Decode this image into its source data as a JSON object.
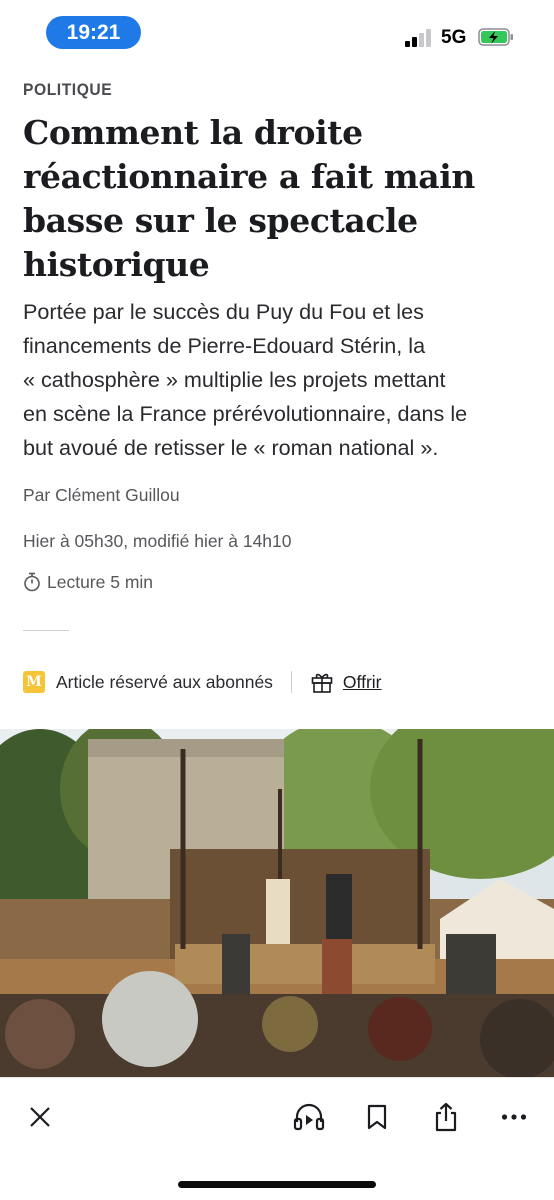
{
  "status_bar": {
    "time": "19:21",
    "network": "5G",
    "time_pill_color": "#1f7ae8",
    "battery_icon": "battery-charging-icon"
  },
  "article": {
    "kicker": "POLITIQUE",
    "headline_lines": [
      "Comment la droite",
      "réactionnaire a fait main",
      "basse sur le spectacle",
      "historique"
    ],
    "lede_lines": [
      "Portée par le succès du Puy du Fou et les",
      "financements de Pierre-Edouard Stérin, la",
      "« cathosphère » multiplie les projets mettant",
      "en scène la France prérévolutionnaire, dans le",
      "but avoué de retisser le « roman national »."
    ],
    "byline": "Par Clément Guillou",
    "dates": "Hier à 05h30, modifié hier à 14h10",
    "reading_time": "Lecture 5 min",
    "subscriber_label": "Article réservé aux abonnés",
    "offer_label": "Offrir",
    "brand_badge_letter": "M",
    "brand_badge_color": "#f6c436"
  },
  "toolbar": {
    "icons": [
      "close-icon",
      "listen-icon",
      "bookmark-icon",
      "share-icon",
      "more-icon"
    ]
  }
}
